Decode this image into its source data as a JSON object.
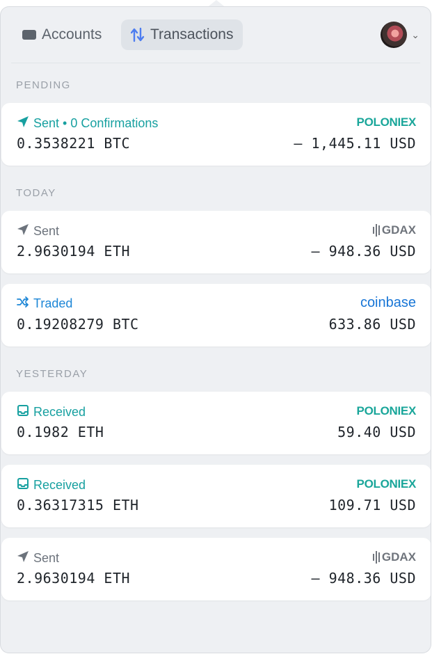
{
  "tabs": {
    "accounts": "Accounts",
    "transactions": "Transactions"
  },
  "sections": {
    "pending": "PENDING",
    "today": "TODAY",
    "yesterday": "YESTERDAY"
  },
  "colors": {
    "teal": "#17a0a0",
    "blue": "#1c86d6",
    "poloniex": "#1aa69a",
    "coinbase": "#1775d6"
  },
  "transactions": [
    {
      "status": "Sent • 0 Confirmations",
      "amount": "0.3538221 BTC",
      "usd": "– 1,445.11 USD",
      "exchange": "POLONIEX",
      "icon": "send-icon"
    },
    {
      "status": "Sent",
      "amount": "2.9630194 ETH",
      "usd": "– 948.36 USD",
      "exchange": "GDAX",
      "icon": "send-icon"
    },
    {
      "status": "Traded",
      "amount": "0.19208279 BTC",
      "usd": "633.86 USD",
      "exchange": "coinbase",
      "icon": "shuffle-icon"
    },
    {
      "status": "Received",
      "amount": "0.1982 ETH",
      "usd": "59.40 USD",
      "exchange": "POLONIEX",
      "icon": "inbox-icon"
    },
    {
      "status": "Received",
      "amount": "0.36317315 ETH",
      "usd": "109.71 USD",
      "exchange": "POLONIEX",
      "icon": "inbox-icon"
    },
    {
      "status": "Sent",
      "amount": "2.9630194 ETH",
      "usd": "– 948.36 USD",
      "exchange": "GDAX",
      "icon": "send-icon"
    }
  ]
}
